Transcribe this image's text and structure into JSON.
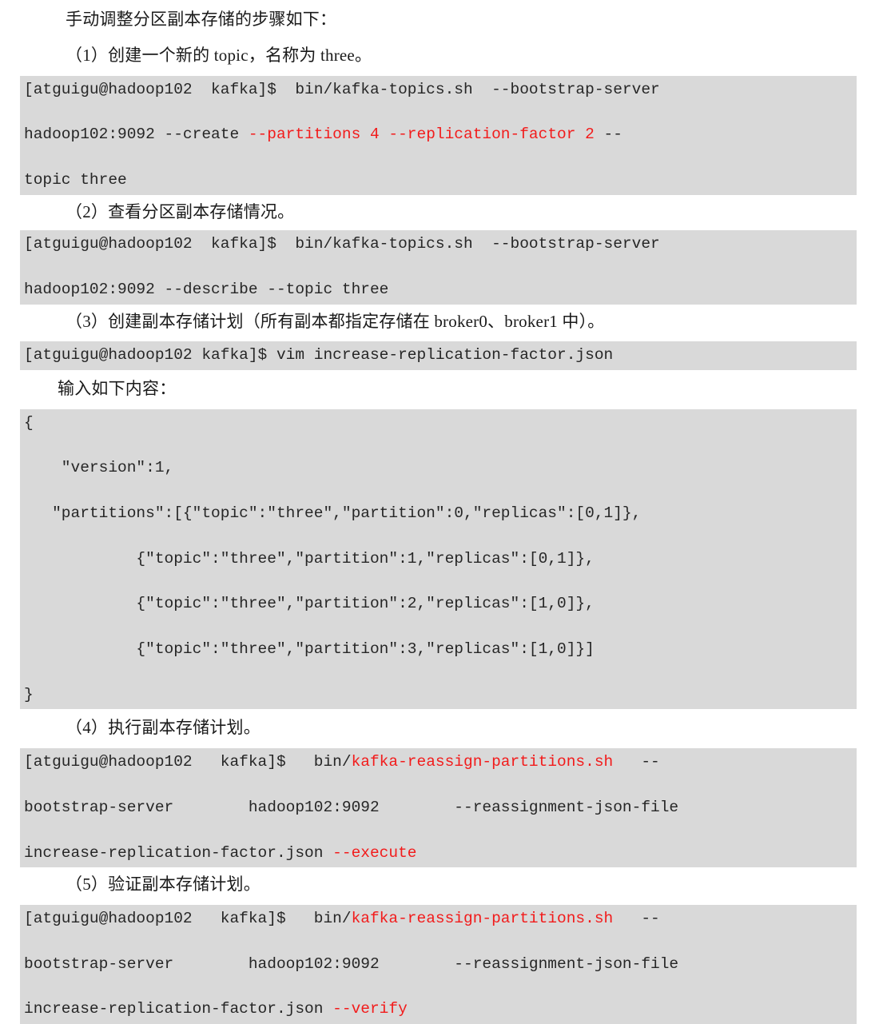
{
  "document": {
    "intro": "手动调整分区副本存储的步骤如下：",
    "steps": [
      {
        "label": "（1）创建一个新的 topic，名称为 three。"
      },
      {
        "label": "（2）查看分区副本存储情况。"
      },
      {
        "label": "（3）创建副本存储计划（所有副本都指定存储在 broker0、broker1 中）。"
      },
      {
        "label": "输入如下内容："
      },
      {
        "label": "（4）执行副本存储计划。"
      },
      {
        "label": "（5）验证副本存储计划。"
      }
    ],
    "code_blocks": {
      "create_topic": {
        "lines": [
          [
            {
              "t": "[atguigu@hadoop102  kafka]$  bin/kafka-topics.sh  --bootstrap-server",
              "c": "plain"
            }
          ],
          [
            {
              "t": "hadoop102:9092 --create ",
              "c": "plain"
            },
            {
              "t": "--partitions 4 --replication-factor 2",
              "c": "red"
            },
            {
              "t": " --",
              "c": "plain"
            }
          ],
          [
            {
              "t": "topic three",
              "c": "plain"
            }
          ]
        ]
      },
      "describe_topic": {
        "lines": [
          [
            {
              "t": "[atguigu@hadoop102  kafka]$  bin/kafka-topics.sh  --bootstrap-server",
              "c": "plain"
            }
          ],
          [
            {
              "t": "hadoop102:9092 --describe --topic three",
              "c": "plain"
            }
          ]
        ]
      },
      "vim_json": {
        "lines": [
          [
            {
              "t": "[atguigu@hadoop102 kafka]$ vim increase-replication-factor.json",
              "c": "plain"
            }
          ]
        ]
      },
      "json_plan": {
        "lines": [
          [
            {
              "t": "{",
              "c": "plain"
            }
          ],
          [
            {
              "t": "    \"version\":1,",
              "c": "plain"
            }
          ],
          [
            {
              "t": "   \"partitions\":[{\"topic\":\"three\",\"partition\":0,\"replicas\":[0,1]},",
              "c": "plain"
            }
          ],
          [
            {
              "t": "            {\"topic\":\"three\",\"partition\":1,\"replicas\":[0,1]},",
              "c": "plain"
            }
          ],
          [
            {
              "t": "            {\"topic\":\"three\",\"partition\":2,\"replicas\":[1,0]},",
              "c": "plain"
            }
          ],
          [
            {
              "t": "            {\"topic\":\"three\",\"partition\":3,\"replicas\":[1,0]}]",
              "c": "plain"
            }
          ],
          [
            {
              "t": "}",
              "c": "plain"
            }
          ]
        ]
      },
      "execute_plan": {
        "lines": [
          [
            {
              "t": "[atguigu@hadoop102   kafka]$   bin/",
              "c": "plain"
            },
            {
              "t": "kafka-reassign-partitions.sh",
              "c": "red"
            },
            {
              "t": "   --",
              "c": "plain"
            }
          ],
          [
            {
              "t": "bootstrap-server        hadoop102:9092        --reassignment-json-file",
              "c": "plain"
            }
          ],
          [
            {
              "t": "increase-replication-factor.json ",
              "c": "plain"
            },
            {
              "t": "--execute",
              "c": "red"
            }
          ]
        ]
      },
      "verify_plan": {
        "lines": [
          [
            {
              "t": "[atguigu@hadoop102   kafka]$   bin/",
              "c": "plain"
            },
            {
              "t": "kafka-reassign-partitions.sh",
              "c": "red"
            },
            {
              "t": "   --",
              "c": "plain"
            }
          ],
          [
            {
              "t": "bootstrap-server        hadoop102:9092        --reassignment-json-file",
              "c": "plain"
            }
          ],
          [
            {
              "t": "increase-replication-factor.json ",
              "c": "plain"
            },
            {
              "t": "--verify",
              "c": "red"
            }
          ]
        ]
      }
    },
    "colors": {
      "code_background": "#d9d9d9",
      "code_text": "#262626",
      "highlight_red": "#f21b1b",
      "page_background": "#ffffff",
      "body_text": "#1a1a1a"
    }
  }
}
